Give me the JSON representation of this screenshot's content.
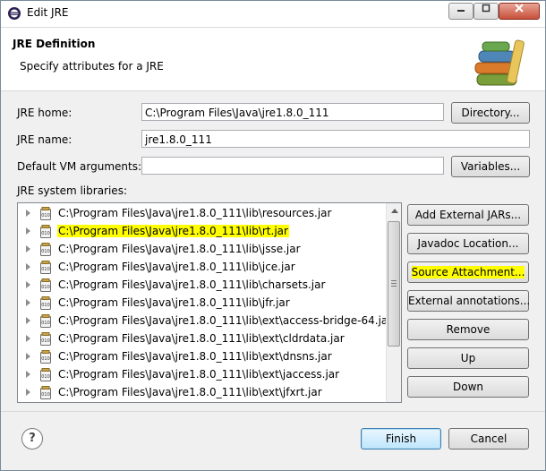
{
  "window": {
    "title": "Edit JRE"
  },
  "header": {
    "title": "JRE Definition",
    "description": "Specify attributes for a JRE"
  },
  "form": {
    "jre_home_label": "JRE home:",
    "jre_home_value": "C:\\Program Files\\Java\\jre1.8.0_111",
    "jre_name_label": "JRE name:",
    "jre_name_value": "jre1.8.0_111",
    "vm_args_label": "Default VM arguments:",
    "vm_args_value": "",
    "libraries_label": "JRE system libraries:"
  },
  "buttons": {
    "directory": "Directory...",
    "variables": "Variables...",
    "add_external_jars": "Add External JARs...",
    "javadoc_location": "Javadoc Location...",
    "source_attachment": "Source Attachment...",
    "external_annotations": "External annotations...",
    "remove": "Remove",
    "up": "Up",
    "down": "Down",
    "finish": "Finish",
    "cancel": "Cancel"
  },
  "libraries": [
    {
      "path": "C:\\Program Files\\Java\\jre1.8.0_111\\lib\\resources.jar",
      "highlighted": false
    },
    {
      "path": "C:\\Program Files\\Java\\jre1.8.0_111\\lib\\rt.jar",
      "highlighted": true
    },
    {
      "path": "C:\\Program Files\\Java\\jre1.8.0_111\\lib\\jsse.jar",
      "highlighted": false
    },
    {
      "path": "C:\\Program Files\\Java\\jre1.8.0_111\\lib\\jce.jar",
      "highlighted": false
    },
    {
      "path": "C:\\Program Files\\Java\\jre1.8.0_111\\lib\\charsets.jar",
      "highlighted": false
    },
    {
      "path": "C:\\Program Files\\Java\\jre1.8.0_111\\lib\\jfr.jar",
      "highlighted": false
    },
    {
      "path": "C:\\Program Files\\Java\\jre1.8.0_111\\lib\\ext\\access-bridge-64.jar",
      "highlighted": false
    },
    {
      "path": "C:\\Program Files\\Java\\jre1.8.0_111\\lib\\ext\\cldrdata.jar",
      "highlighted": false
    },
    {
      "path": "C:\\Program Files\\Java\\jre1.8.0_111\\lib\\ext\\dnsns.jar",
      "highlighted": false
    },
    {
      "path": "C:\\Program Files\\Java\\jre1.8.0_111\\lib\\ext\\jaccess.jar",
      "highlighted": false
    },
    {
      "path": "C:\\Program Files\\Java\\jre1.8.0_111\\lib\\ext\\jfxrt.jar",
      "highlighted": false
    }
  ],
  "help_symbol": "?",
  "colors": {
    "highlight": "#ffff00",
    "default_button": "#3c7fb1"
  }
}
